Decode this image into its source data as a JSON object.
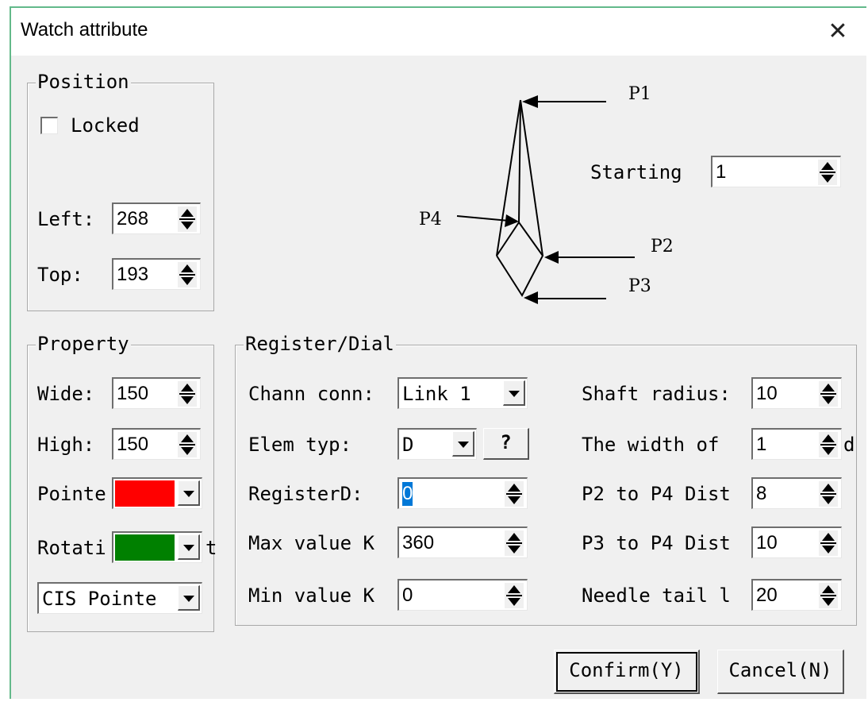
{
  "window": {
    "title": "Watch attribute",
    "close_glyph": "✕"
  },
  "position": {
    "legend": "Position",
    "locked_label": "Locked",
    "locked": false,
    "left_label": "Left:",
    "left_value": "268",
    "top_label": "Top:",
    "top_value": "193"
  },
  "diagram": {
    "p1": "P1",
    "p2": "P2",
    "p3": "P3",
    "p4": "P4",
    "starting_label": "Starting",
    "starting_value": "1"
  },
  "property": {
    "legend": "Property",
    "wide_label": "Wide:",
    "wide_value": "150",
    "high_label": "High:",
    "high_value": "150",
    "pointer_label": "Pointe",
    "pointer_color": "#ff0000",
    "rotation_label": "Rotati",
    "rotation_color": "#008000",
    "rotation_suffix": "t",
    "style_value": "CIS Pointe"
  },
  "register": {
    "legend": "Register/Dial",
    "chann_label": "Chann conn:",
    "chann_value": "Link 1",
    "elem_label": "Elem typ:",
    "elem_value": "D",
    "help_label": "?",
    "registerd_label": "RegisterD:",
    "registerd_value": "0",
    "max_label": "Max value K",
    "max_value": "360",
    "min_label": "Min value K",
    "min_value": "0",
    "shaft_label": "Shaft radius:",
    "shaft_value": "10",
    "width_label": "The width of",
    "width_value": "1",
    "width_suffix": "d",
    "p2p4_label": "P2 to P4 Dist",
    "p2p4_value": "8",
    "p3p4_label": "P3 to P4 Dist",
    "p3p4_value": "10",
    "tail_label": "Needle tail l",
    "tail_value": "20"
  },
  "buttons": {
    "confirm": "Confirm(Y)",
    "cancel": "Cancel(N)"
  }
}
